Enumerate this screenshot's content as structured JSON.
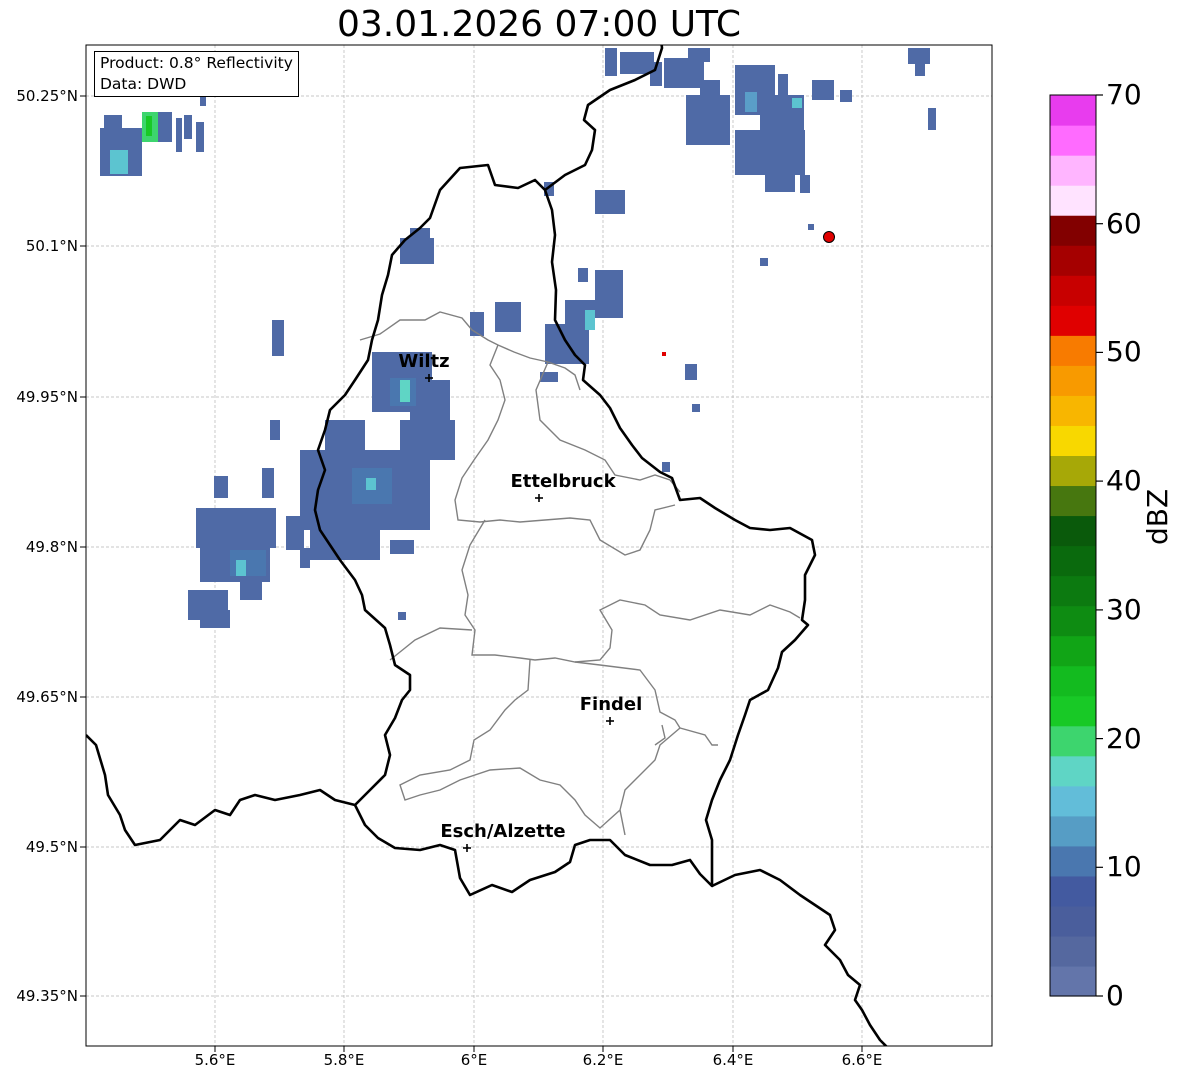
{
  "title": "03.01.2026 07:00 UTC",
  "info": {
    "product": "Product: 0.8° Reflectivity",
    "data": "Data: DWD"
  },
  "lat_labels": [
    "50.25°N",
    "50.1°N",
    "49.95°N",
    "49.8°N",
    "49.65°N",
    "49.5°N",
    "49.35°N"
  ],
  "lon_labels": [
    "5.6°E",
    "5.8°E",
    "6°E",
    "6.2°E",
    "6.4°E",
    "6.6°E"
  ],
  "cities": [
    {
      "name": "Wiltz"
    },
    {
      "name": "Ettelbruck"
    },
    {
      "name": "Findel"
    },
    {
      "name": "Esch/Alzette"
    }
  ],
  "colorbar": {
    "label": "dBZ",
    "ticks": [
      "0",
      "10",
      "20",
      "30",
      "40",
      "50",
      "60",
      "70"
    ],
    "min": 0,
    "max": 70,
    "step": 2.5,
    "colors": [
      "#6375aa",
      "#55689f",
      "#4a5e9c",
      "#435aa0",
      "#4a77af",
      "#569dc5",
      "#62bdd9",
      "#5fd5c5",
      "#3dd56e",
      "#18c926",
      "#13bb1f",
      "#11a516",
      "#0e8c12",
      "#0c7a10",
      "#0a6a0d",
      "#0a5a0b",
      "#47770f",
      "#a7a807",
      "#f8d800",
      "#f8b600",
      "#f89a00",
      "#f87b00",
      "#e00000",
      "#c80000",
      "#a50000",
      "#820000",
      "#ffe3ff",
      "#ffb5ff",
      "#ff6bff",
      "#e83cee"
    ]
  },
  "radar_site_color": "#e00000"
}
